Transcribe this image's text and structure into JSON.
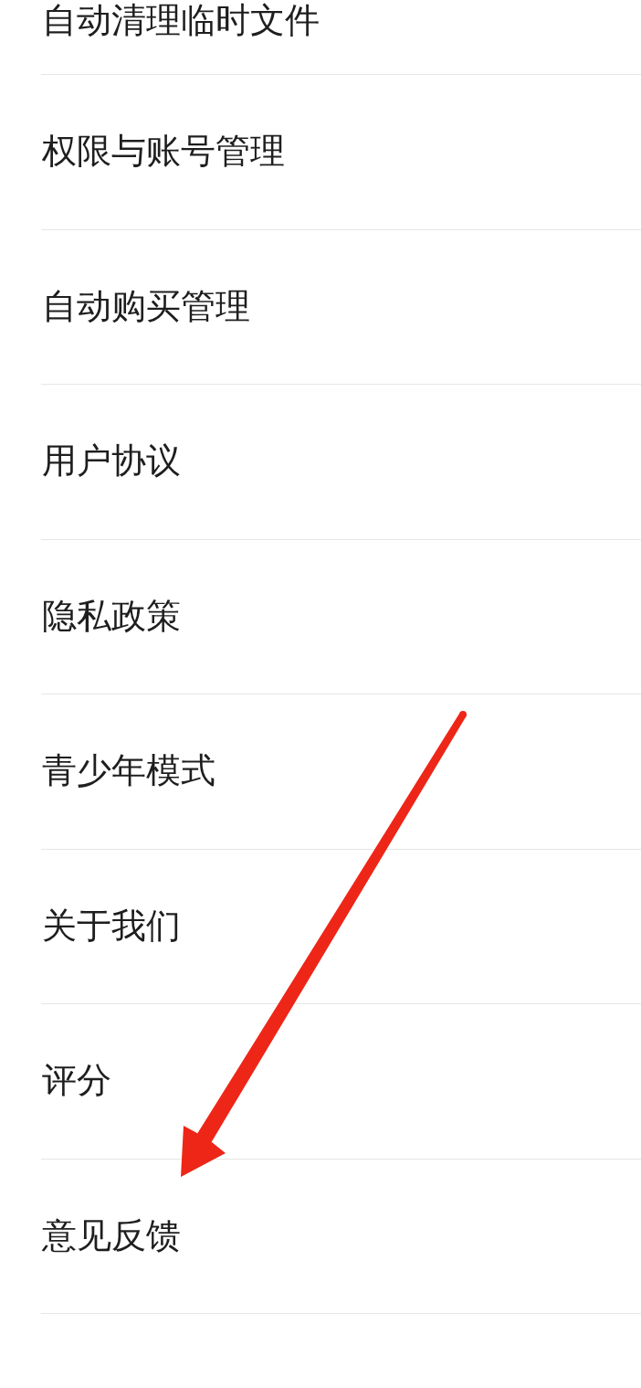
{
  "settings_list": {
    "items": [
      {
        "label": "自动清理临时文件"
      },
      {
        "label": "权限与账号管理"
      },
      {
        "label": "自动购买管理"
      },
      {
        "label": "用户协议"
      },
      {
        "label": "隐私政策"
      },
      {
        "label": "青少年模式"
      },
      {
        "label": "关于我们"
      },
      {
        "label": "评分"
      },
      {
        "label": "意见反馈"
      }
    ]
  }
}
